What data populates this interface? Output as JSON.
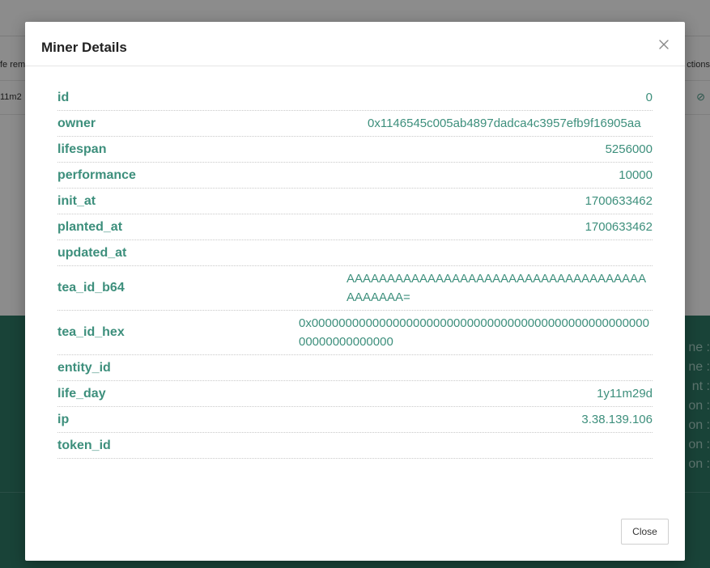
{
  "background": {
    "table_head_left": "fe rem",
    "table_head_right": "ctions",
    "row_left": "11m2",
    "row_icons": "✎ ⊘",
    "panel_labels": [
      "ne :",
      "ne :",
      "nt :",
      "on :",
      "on :",
      "on :",
      "on :"
    ]
  },
  "modal": {
    "title": "Miner Details",
    "close_button_label": "Close",
    "fields": [
      {
        "key": "id",
        "value": "0"
      },
      {
        "key": "owner",
        "value": "0x1146545c005ab4897dadca4c3957efb9f16905aa"
      },
      {
        "key": "lifespan",
        "value": "5256000"
      },
      {
        "key": "performance",
        "value": "10000"
      },
      {
        "key": "init_at",
        "value": "1700633462"
      },
      {
        "key": "planted_at",
        "value": "1700633462"
      },
      {
        "key": "updated_at",
        "value": ""
      },
      {
        "key": "tea_id_b64",
        "value": "AAAAAAAAAAAAAAAAAAAAAAAAAAAAAAAAAAAAAAAAAAAA="
      },
      {
        "key": "tea_id_hex",
        "value": "0x0000000000000000000000000000000000000000000000000000000000000000"
      },
      {
        "key": "entity_id",
        "value": ""
      },
      {
        "key": "life_day",
        "value": "1y11m29d"
      },
      {
        "key": "ip",
        "value": "3.38.139.106"
      },
      {
        "key": "token_id",
        "value": ""
      }
    ]
  },
  "colors": {
    "accent": "#3d8f7c",
    "panel": "#2f7a67"
  }
}
